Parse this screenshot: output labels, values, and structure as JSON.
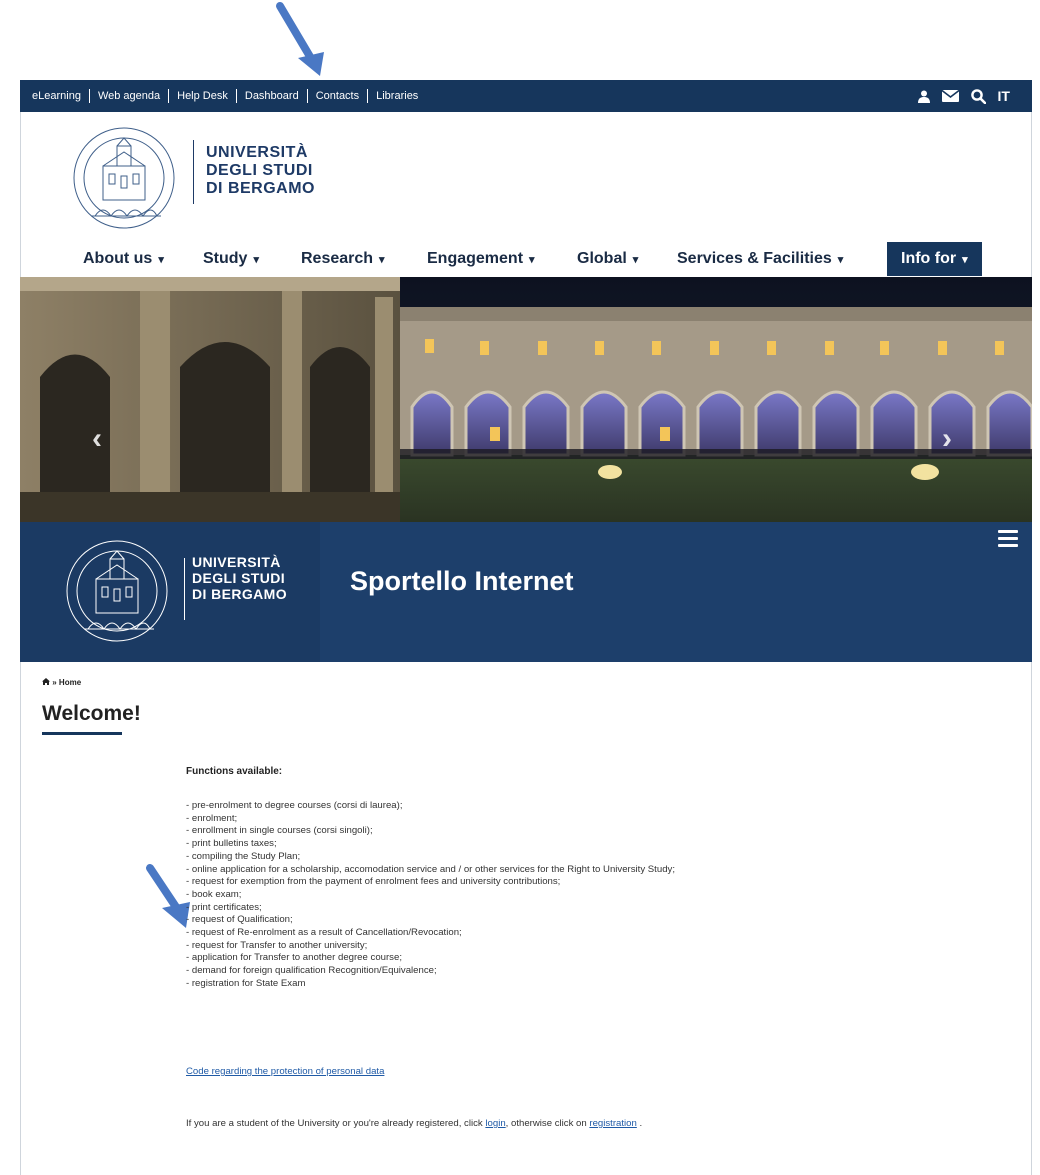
{
  "colors": {
    "navy": "#16365c",
    "band": "#1d3f6b",
    "annotation_arrow": "#4a78c4",
    "link": "#1f5aa6"
  },
  "topbar": {
    "links": [
      "eLearning",
      "Web agenda",
      "Help Desk",
      "Dashboard",
      "Contacts",
      "Libraries"
    ],
    "language": "IT",
    "icons": [
      "user-icon",
      "mail-icon",
      "search-icon"
    ]
  },
  "header": {
    "logo_line1": "UNIVERSITÀ",
    "logo_line2": "DEGLI STUDI",
    "logo_line3": "DI BERGAMO"
  },
  "nav": {
    "items": [
      "About us",
      "Study",
      "Research",
      "Engagement",
      "Global",
      "Services & Facilities",
      "Info for"
    ],
    "active": "Info for"
  },
  "hero": {
    "prev_icon": "chevron-left-icon",
    "next_icon": "chevron-right-icon"
  },
  "band": {
    "logo_line1": "UNIVERSITÀ",
    "logo_line2": "DEGLI STUDI",
    "logo_line3": "DI BERGAMO",
    "title": "Sportello Internet"
  },
  "content": {
    "breadcrumb_sep": "»",
    "breadcrumb_home": "Home",
    "welcome": "Welcome!",
    "functions_title": "Functions available:",
    "functions": [
      "- pre-enrolment to degree courses (corsi di laurea);",
      "- enrolment;",
      "- enrollment in single courses (corsi singoli);",
      "- print bulletins taxes;",
      "- compiling the Study Plan;",
      "- online application for a scholarship, accomodation service and / or other services for the Right to University Study;",
      "- request for exemption from the payment of enrolment fees and university contributions;",
      "- book exam;",
      "- print certificates;",
      "- request of Qualification;",
      "- request of Re-enrolment as a result of Cancellation/Revocation;",
      "- request for Transfer to another university;",
      "- application for Transfer to another degree course;",
      "- demand for foreign qualification Recognition/Equivalence;",
      "- registration for State Exam"
    ],
    "privacy_link": "Code regarding the protection of personal data",
    "bottom_prefix": "If you are a student of the University or you're already registered, click",
    "login_link": "login",
    "bottom_middle": ", otherwise click on",
    "registration_link": "registration",
    "bottom_suffix": "."
  }
}
